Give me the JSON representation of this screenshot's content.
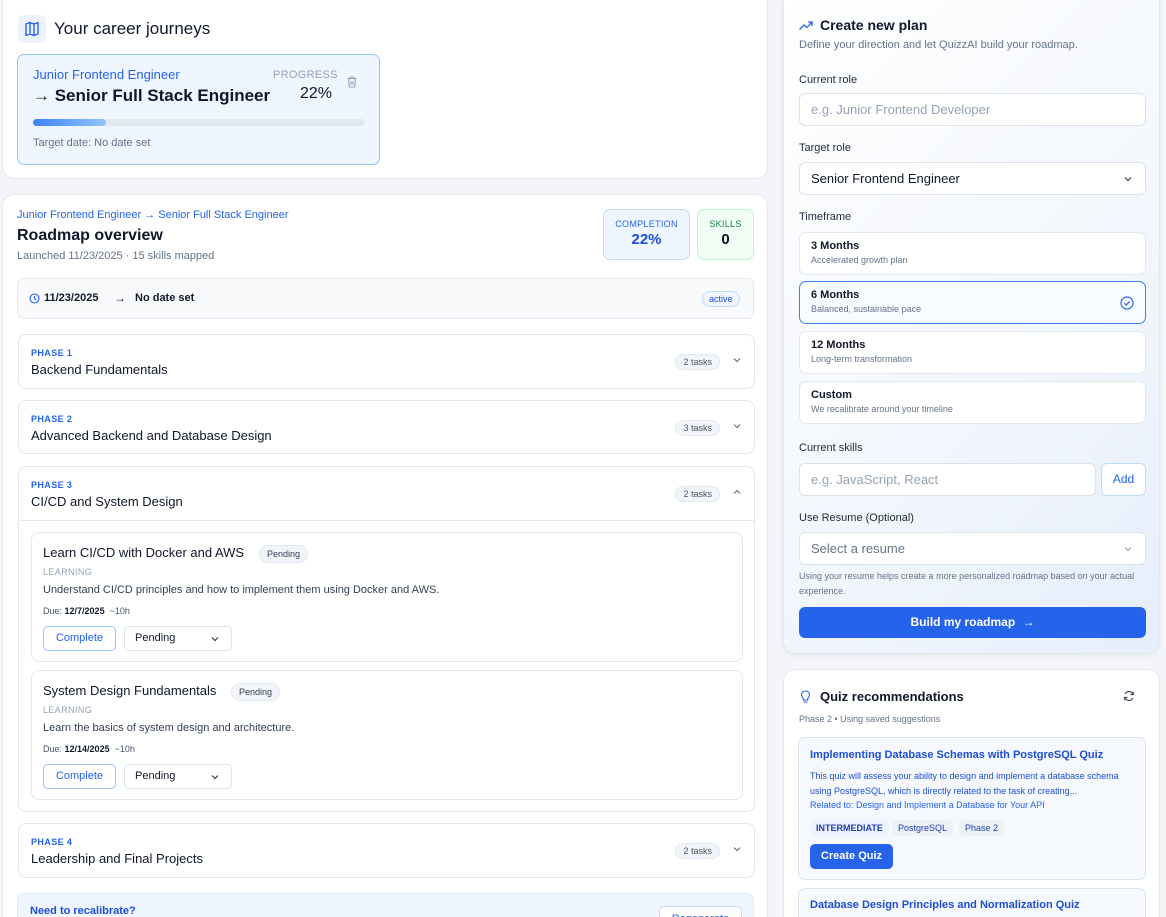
{
  "journeys": {
    "title": "Your career journeys",
    "card": {
      "from": "Junior Frontend Engineer",
      "to": "→ Senior Full Stack Engineer",
      "progress_label": "PROGRESS",
      "progress_value": "22%",
      "progress_fraction": 0.22,
      "target_date": "Target date: No date set"
    }
  },
  "roadmap": {
    "breadcrumb": "Junior Frontend Engineer → Senior Full Stack Engineer",
    "title": "Roadmap overview",
    "subtitle": "Launched 11/23/2025 · 15 skills mapped",
    "completion_label": "COMPLETION",
    "completion_value": "22%",
    "skills_label": "SKILLS",
    "skills_value": "0",
    "timeline": {
      "start": "11/23/2025",
      "arrow": "→",
      "end": "No date set",
      "status": "active"
    },
    "phases": [
      {
        "label": "PHASE 1",
        "title": "Backend Fundamentals",
        "count": "2 tasks"
      },
      {
        "label": "PHASE 2",
        "title": "Advanced Backend and Database Design",
        "count": "3 tasks"
      },
      {
        "label": "PHASE 3",
        "title": "CI/CD and System Design",
        "count": "2 tasks"
      },
      {
        "label": "PHASE 4",
        "title": "Leadership and Final Projects",
        "count": "2 tasks"
      }
    ],
    "tasks": [
      {
        "title": "Learn CI/CD with Docker and AWS",
        "status": "Pending",
        "category": "LEARNING",
        "description": "Understand CI/CD principles and how to implement them using Docker and AWS.",
        "due_label": "Due:",
        "due_date": "12/7/2025",
        "hours": "~10h",
        "complete_label": "Complete",
        "select_value": "Pending"
      },
      {
        "title": "System Design Fundamentals",
        "status": "Pending",
        "category": "LEARNING",
        "description": "Learn the basics of system design and architecture.",
        "due_label": "Due:",
        "due_date": "12/14/2025",
        "hours": "~10h",
        "complete_label": "Complete",
        "select_value": "Pending"
      }
    ],
    "recalibrate": {
      "title": "Need to recalibrate?",
      "button": "Regenerate"
    }
  },
  "plan": {
    "title": "Create new plan",
    "subtitle": "Define your direction and let QuizzAI build your roadmap.",
    "current_role_label": "Current role",
    "current_role_placeholder": "e.g. Junior Frontend Developer",
    "target_role_label": "Target role",
    "target_role_value": "Senior Frontend Engineer",
    "timeframe_label": "Timeframe",
    "timeframes": [
      {
        "title": "3 Months",
        "sub": "Accelerated growth plan"
      },
      {
        "title": "6 Months",
        "sub": "Balanced, sustainable pace"
      },
      {
        "title": "12 Months",
        "sub": "Long-term transformation"
      },
      {
        "title": "Custom",
        "sub": "We recalibrate around your timeline"
      }
    ],
    "skills_label": "Current skills",
    "skills_placeholder": "e.g. JavaScript, React",
    "add_button": "Add",
    "resume_label": "Use Resume (Optional)",
    "resume_placeholder": "Select a resume",
    "resume_hint": "Using your resume helps create a more personalized roadmap based on your actual experience.",
    "build_button": "Build my roadmap",
    "build_arrow": "→"
  },
  "quiz": {
    "title": "Quiz recommendations",
    "subtitle": "Phase 2 • Using saved suggestions",
    "items": [
      {
        "title": "Implementing Database Schemas with PostgreSQL Quiz",
        "desc": "This quiz will assess your ability to design and implement a database schema using PostgreSQL, which is directly related to the task of creating...",
        "related": "Related to: Design and Implement a Database for Your API",
        "tags": [
          "INTERMEDIATE",
          "PostgreSQL",
          "Phase 2"
        ],
        "button": "Create Quiz"
      },
      {
        "title": "Database Design Principles and Normalization Quiz"
      }
    ]
  },
  "colors": {
    "accent": "#2563eb",
    "progress_start": "#3b82f6",
    "progress_end": "#93c5fd"
  }
}
